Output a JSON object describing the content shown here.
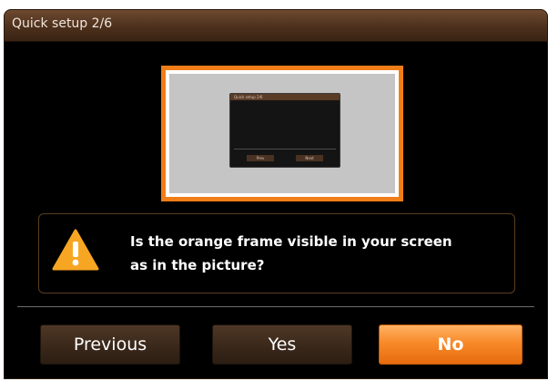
{
  "window": {
    "title": "Quick setup 2/6"
  },
  "preview": {
    "mini_title": "Quick setup 2/6",
    "mini_buttons": [
      "Prev",
      "Next"
    ]
  },
  "message": {
    "line1": "Is the orange frame visible in your screen",
    "line2": "as in the picture?",
    "icon": "warning-icon"
  },
  "buttons": {
    "previous": "Previous",
    "yes": "Yes",
    "no": "No"
  },
  "colors": {
    "accent": "#f07d18",
    "titlebar": "#4c301c",
    "background": "#000000"
  }
}
